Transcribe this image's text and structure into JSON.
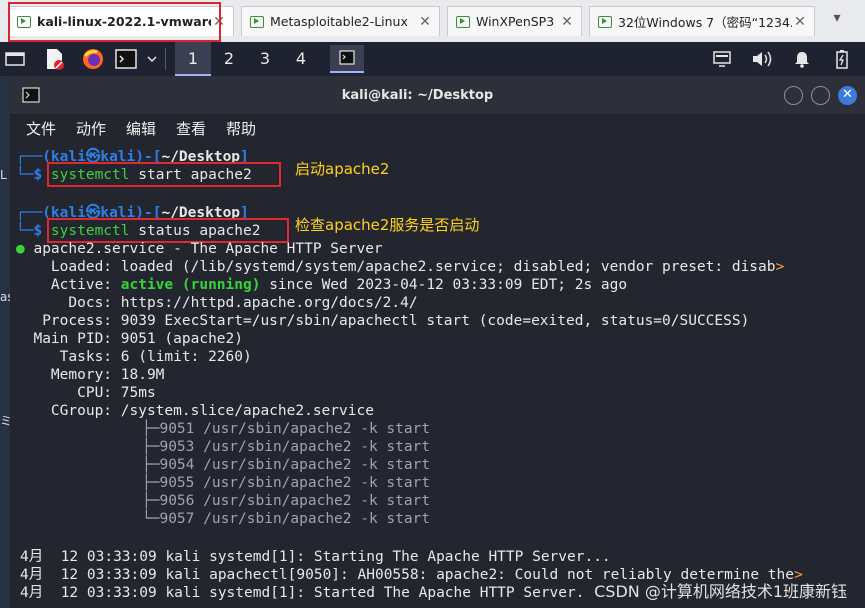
{
  "vmware_tabs": [
    {
      "label": "kali-linux-2022.1-vmware..."
    },
    {
      "label": "Metasploitable2-Linux"
    },
    {
      "label": "WinXPenSP3"
    },
    {
      "label": "32位Windows 7（密码“1234..."
    }
  ],
  "vm_tab_close": "✕",
  "panel": {
    "workspaces": [
      "1",
      "2",
      "3",
      "4"
    ]
  },
  "terminal": {
    "title": "kali@kali: ~/Desktop",
    "menu": [
      "文件",
      "动作",
      "编辑",
      "查看",
      "帮助"
    ],
    "prompt": {
      "user": "kali",
      "at": "㉿",
      "host": "kali",
      "dir": "~/Desktop"
    },
    "commands": [
      {
        "cmd": "systemctl",
        "args": "start apache2",
        "note": "启动apache2"
      },
      {
        "cmd": "systemctl",
        "args": "status apache2",
        "note": "检查apache2服务是否启动"
      }
    ],
    "status": {
      "unit_line": "apache2.service - The Apache HTTP Server",
      "loaded_label": "Loaded:",
      "loaded_value": "loaded (/lib/systemd/system/apache2.service; disabled; vendor preset: disab",
      "active_label": "Active:",
      "active_state": "active (running)",
      "active_since": "since Wed 2023-04-12 03:33:09 EDT; 2s ago",
      "docs_label": "Docs:",
      "docs_value": "https://httpd.apache.org/docs/2.4/",
      "process_label": "Process:",
      "process_value": "9039 ExecStart=/usr/sbin/apachectl start (code=exited, status=0/SUCCESS)",
      "mainpid_label": "Main PID:",
      "mainpid_value": "9051 (apache2)",
      "tasks_label": "Tasks:",
      "tasks_value": "6 (limit: 2260)",
      "memory_label": "Memory:",
      "memory_value": "18.9M",
      "cpu_label": "CPU:",
      "cpu_value": "75ms",
      "cgroup_label": "CGroup:",
      "cgroup_value": "/system.slice/apache2.service",
      "processes": [
        "├─9051 /usr/sbin/apache2 -k start",
        "├─9053 /usr/sbin/apache2 -k start",
        "├─9054 /usr/sbin/apache2 -k start",
        "├─9055 /usr/sbin/apache2 -k start",
        "├─9056 /usr/sbin/apache2 -k start",
        "└─9057 /usr/sbin/apache2 -k start"
      ]
    },
    "log_lines": [
      "4月  12 03:33:09 kali systemd[1]: Starting The Apache HTTP Server...",
      "4月  12 03:33:09 kali apachectl[9050]: AH00558: apache2: Could not reliably determine the",
      "4月  12 03:33:09 kali systemd[1]: Started The Apache HTTP Server."
    ],
    "overflow_marker": ">"
  },
  "desktop_fragments": [
    "L",
    "as",
    "ミ"
  ],
  "watermark": "CSDN @计算机网络技术1班康新钰",
  "colors": {
    "prompt_blue": "#2f7fe8",
    "command_green": "#3bd13b",
    "annotation_yellow": "#ffd21a",
    "highlight_red": "#e0282e"
  }
}
